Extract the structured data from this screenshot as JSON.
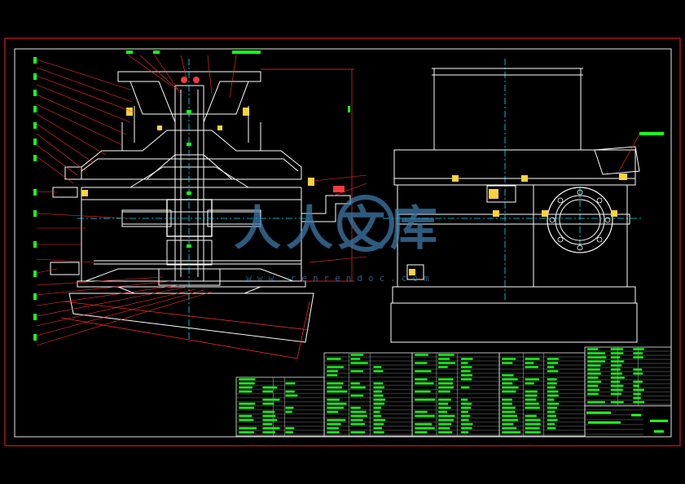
{
  "drawing": {
    "background": "#000000",
    "colors": {
      "border": "#ff2020",
      "frame": "#e8e8e8",
      "outline": "#ffffff",
      "centerline": "#00e5ff",
      "dimension": "#ff3030",
      "leader": "#ff3030",
      "text": "#19ff19",
      "accent": "#ff3a3a",
      "watermark": "#3f7fb0"
    }
  },
  "watermark": {
    "brand": "人人文库",
    "url": "www.renrendoc.com"
  },
  "views": [
    {
      "name": "section-view",
      "icon": "centrifuge-section-icon"
    },
    {
      "name": "side-view",
      "icon": "centrifuge-side-elevation-icon"
    }
  ],
  "title_block": {
    "parts_tables": 4
  }
}
